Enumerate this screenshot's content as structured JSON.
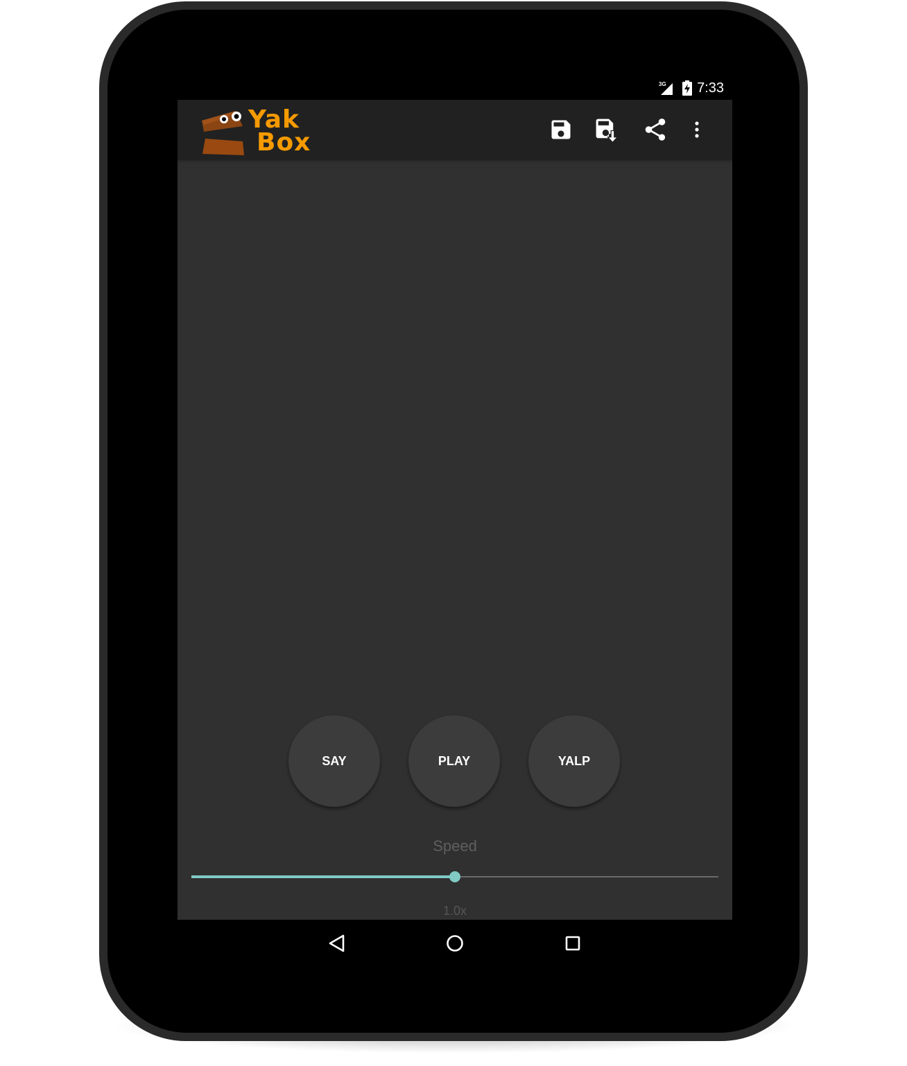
{
  "status_bar": {
    "time": "7:33",
    "network": "3G",
    "signal_icon": "cellular-signal-icon",
    "battery_icon": "battery-charging-icon"
  },
  "app_bar": {
    "logo": {
      "line1": "Yak",
      "line2": "Box"
    },
    "actions": [
      {
        "icon": "save-icon"
      },
      {
        "icon": "save-as-icon"
      },
      {
        "icon": "share-icon"
      },
      {
        "icon": "overflow-menu-icon"
      }
    ]
  },
  "controls": {
    "say_label": "SAY",
    "play_label": "PLAY",
    "yalp_label": "YALP"
  },
  "speed": {
    "label": "Speed",
    "value_text": "1.0x",
    "position_fraction": 0.5
  },
  "nav_bar": {
    "back_icon": "back-triangle-icon",
    "home_icon": "home-circle-icon",
    "recents_icon": "recents-square-icon"
  },
  "colors": {
    "accent": "#80cbc4",
    "logo_orange": "#f59a00",
    "logo_brown": "#8b4513",
    "screen_bg": "#303030",
    "app_bar_bg": "#212121",
    "button_bg": "#3c3c3c"
  }
}
